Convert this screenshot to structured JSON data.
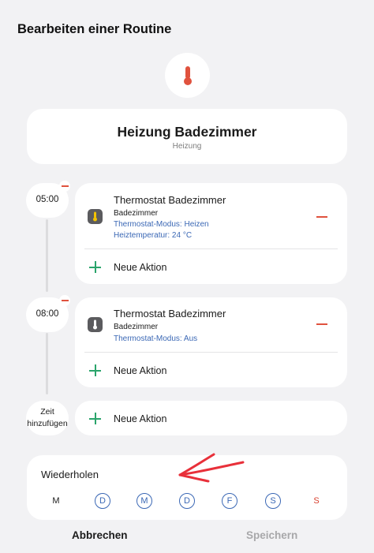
{
  "header": {
    "title": "Bearbeiten einer Routine"
  },
  "routine": {
    "icon": "thermometer-icon",
    "icon_color": "#e0523e",
    "name": "Heizung Badezimmer",
    "type": "Heizung"
  },
  "slots": [
    {
      "time": "05:00",
      "action": {
        "device": "Thermostat Badezimmer",
        "room": "Badezimmer",
        "details": [
          "Thermostat-Modus: Heizen",
          "Heiztemperatur: 24 °C"
        ],
        "icon": "thermostat-icon",
        "icon_accent": "#f2c200"
      },
      "add_label": "Neue Aktion"
    },
    {
      "time": "08:00",
      "action": {
        "device": "Thermostat Badezimmer",
        "room": "Badezimmer",
        "details": [
          "Thermostat-Modus: Aus"
        ],
        "icon": "thermostat-icon",
        "icon_accent": "#ffffff"
      },
      "add_label": "Neue Aktion"
    }
  ],
  "add_time": {
    "label_line1": "Zeit",
    "label_line2": "hinzufügen",
    "add_label": "Neue Aktion"
  },
  "repeat": {
    "label": "Wiederholen",
    "days": [
      {
        "letter": "M",
        "selected": false
      },
      {
        "letter": "D",
        "selected": true
      },
      {
        "letter": "M",
        "selected": true
      },
      {
        "letter": "D",
        "selected": true
      },
      {
        "letter": "F",
        "selected": true
      },
      {
        "letter": "S",
        "selected": true
      },
      {
        "letter": "S",
        "selected": false,
        "weekend": true
      }
    ]
  },
  "footer": {
    "cancel": "Abbrechen",
    "save": "Speichern"
  },
  "colors": {
    "accent_blue": "#3b68b5",
    "remove_red": "#e0523e",
    "add_green": "#2aa46b",
    "annotation_arrow": "#e8303a"
  }
}
